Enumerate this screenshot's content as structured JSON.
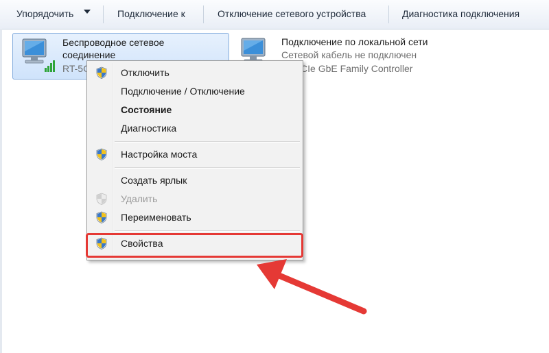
{
  "toolbar": {
    "organize": "Упорядочить",
    "connect": "Подключение к",
    "disable": "Отключение сетевого устройства",
    "diagnose": "Диагностика подключения"
  },
  "adapters": [
    {
      "name_line1": "Беспроводное сетевое",
      "name_line2": "соединение",
      "detail": "RT-5G"
    },
    {
      "name": "Подключение по локальной сети",
      "status": "Сетевой кабель не подключен",
      "device": "ek PCIe GbE Family Controller"
    }
  ],
  "context_menu": {
    "items": [
      {
        "label": "Отключить",
        "icon": "uac-shield-icon"
      },
      {
        "label": "Подключение / Отключение",
        "icon": ""
      },
      {
        "label": "Состояние",
        "icon": "",
        "bold": true
      },
      {
        "label": "Диагностика",
        "icon": ""
      },
      {
        "label": "Настройка моста",
        "icon": "uac-shield-icon"
      },
      {
        "label": "Создать ярлык",
        "icon": ""
      },
      {
        "label": "Удалить",
        "icon": "uac-shield-icon",
        "disabled": true
      },
      {
        "label": "Переименовать",
        "icon": "uac-shield-icon"
      },
      {
        "label": "Свойства",
        "icon": "uac-shield-icon"
      }
    ]
  },
  "colors": {
    "highlight": "#e53935",
    "selected_tile": "#cfe3fb"
  }
}
